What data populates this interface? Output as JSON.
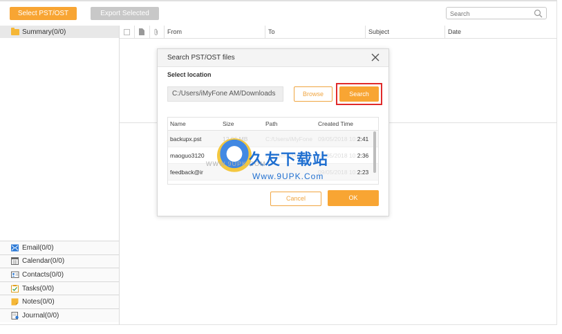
{
  "toolbar": {
    "select_label": "Select PST/OST",
    "export_label": "Export Selected",
    "search_placeholder": "Search",
    "search_icon": "magnifier-icon"
  },
  "sidebar": {
    "summary_label": "Summary(0/0)",
    "summary_icon": "folder-icon",
    "categories": [
      {
        "label": "Email(0/0)",
        "icon": "email-icon"
      },
      {
        "label": "Calendar(0/0)",
        "icon": "calendar-icon"
      },
      {
        "label": "Contacts(0/0)",
        "icon": "contacts-icon"
      },
      {
        "label": "Tasks(0/0)",
        "icon": "tasks-icon"
      },
      {
        "label": "Notes(0/0)",
        "icon": "notes-icon"
      },
      {
        "label": "Journal(0/0)",
        "icon": "journal-icon"
      }
    ]
  },
  "table": {
    "columns": [
      "From",
      "To",
      "Subject",
      "Date"
    ]
  },
  "dialog": {
    "title": "Search PST/OST files",
    "select_location_label": "Select location",
    "path_value": "C:/Users/iMyFone AM/Downloads",
    "browse_label": "Browse",
    "search_label": "Search",
    "cancel_label": "Cancel",
    "ok_label": "OK",
    "results": {
      "columns": [
        "Name",
        "Size",
        "Path",
        "Created Time"
      ],
      "rows": [
        {
          "name": "backupx.pst",
          "size": "12.06 MB",
          "path": "C:/Users/iMyFone",
          "time_faded": "09/05/2018 10:",
          "time": "2:41"
        },
        {
          "name": "maoguo3120",
          "size": "",
          "path": "C:/Users/iMyFone",
          "time_faded": "09/05/2018 10:",
          "time": "2:36"
        },
        {
          "name": "feedback@ir",
          "size": "",
          "path": "",
          "time_faded": "09/05/2018 10:",
          "time": "2:23"
        }
      ]
    }
  },
  "watermark": {
    "chinese": "久友下载站",
    "url_small": "WWW.9UPK.COM",
    "url_large": "Www.9UPK.Com"
  },
  "colors": {
    "accent": "#f8a533",
    "disabled": "#c8c8c8",
    "highlight_border": "#e02a2a",
    "watermark_blue": "#1f6fd0"
  }
}
